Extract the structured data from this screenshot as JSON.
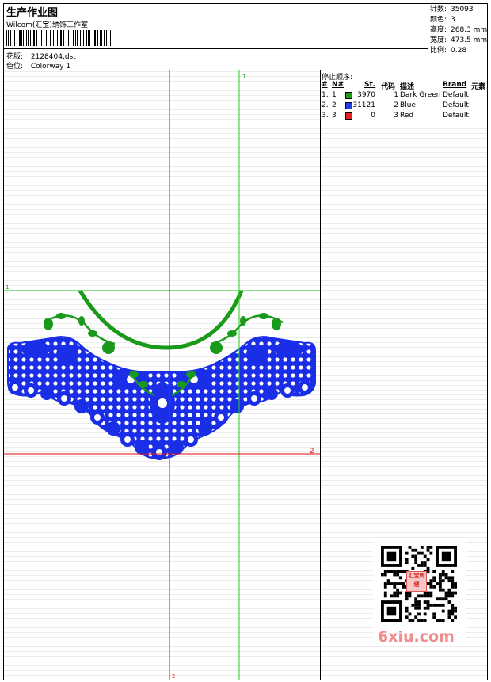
{
  "header": {
    "title": "生产作业图",
    "company": "Wilcom(汇宝)绣饰工作室",
    "file_label": "花版:",
    "file_value": "2128404.dst",
    "colorway_label": "色位:",
    "colorway_value": "Colorway 1"
  },
  "stats": {
    "stitches_label": "针数:",
    "stitches_value": "35093",
    "colors_label": "颜色:",
    "colors_value": "3",
    "height_label": "高度:",
    "height_value": "268.3 mm",
    "width_label": "宽度:",
    "width_value": "473.5 mm",
    "scale_label": "比例:",
    "scale_value": "0.28"
  },
  "stop_sequence": {
    "title": "停止顺序:",
    "headers": {
      "num": "#",
      "n": "N#",
      "st": "St.",
      "code": "代码",
      "desc": "描述",
      "brand": "Brand",
      "element": "元素"
    },
    "rows": [
      {
        "num": "1.",
        "n": "1",
        "color": "#1f9a1f",
        "st": "3970",
        "code": "1",
        "desc": "Dark Green",
        "brand": "Default"
      },
      {
        "num": "2.",
        "n": "2",
        "color": "#1f3ee6",
        "st": "31121",
        "code": "2",
        "desc": "Blue",
        "brand": "Default"
      },
      {
        "num": "3.",
        "n": "3",
        "color": "#e61f1f",
        "st": "0",
        "code": "3",
        "desc": "Red",
        "brand": "Default"
      }
    ]
  },
  "guides": {
    "v_green_label": "1",
    "h_green_label": "1",
    "h_red_label": "2",
    "v_red_label": "2"
  },
  "colors": {
    "green": "#1a9a1a",
    "blue": "#1a2ee8",
    "red": "#e82020",
    "guide_green": "#22cc22",
    "guide_red": "#dd1111"
  },
  "watermark": {
    "text": "6xiu.com",
    "stamp": "汇宝刺绣"
  }
}
